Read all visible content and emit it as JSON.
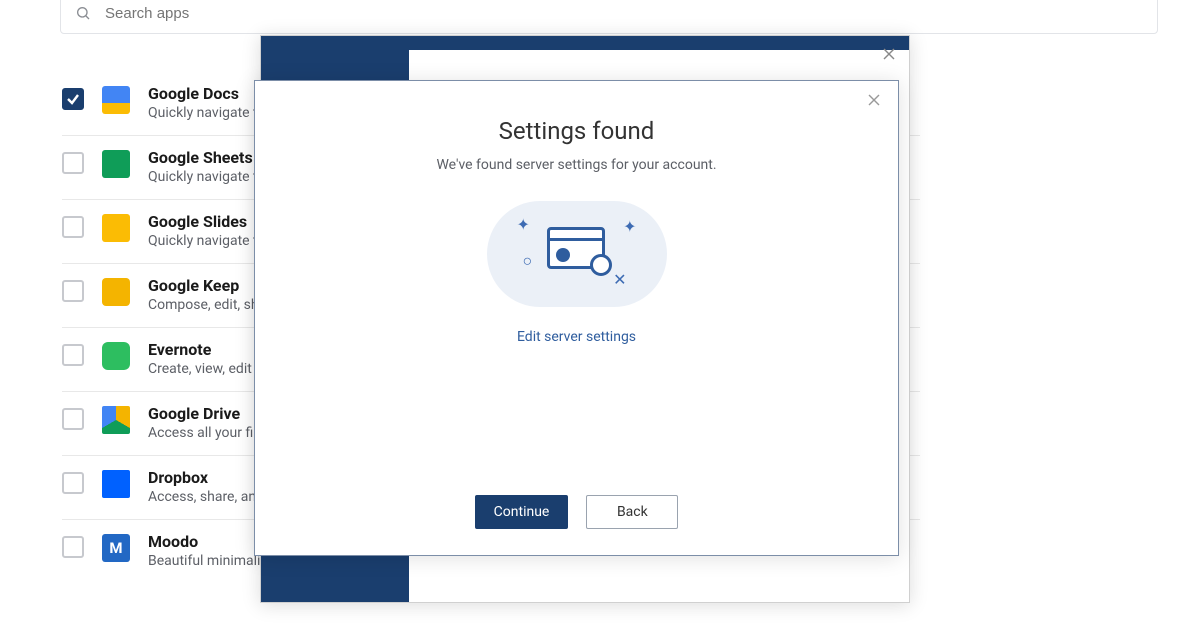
{
  "search": {
    "placeholder": "Search apps"
  },
  "apps": [
    {
      "title": "Google Docs",
      "sub": "Quickly navigate to y",
      "checked": true,
      "iconClass": "ico-docs",
      "iconText": ""
    },
    {
      "title": "Google Sheets",
      "sub": "Quickly navigate to y",
      "checked": false,
      "iconClass": "ico-sheets",
      "iconText": ""
    },
    {
      "title": "Google Slides",
      "sub": "Quickly navigate to y",
      "checked": false,
      "iconClass": "ico-slides",
      "iconText": ""
    },
    {
      "title": "Google Keep",
      "sub": "Compose, edit, share",
      "checked": false,
      "iconClass": "ico-keep",
      "iconText": ""
    },
    {
      "title": "Evernote",
      "sub": "Create, view, edit not",
      "checked": false,
      "iconClass": "ico-evernote",
      "iconText": ""
    },
    {
      "title": "Google Drive",
      "sub": "Access all your files in",
      "checked": false,
      "iconClass": "ico-drive",
      "iconText": ""
    },
    {
      "title": "Dropbox",
      "sub": "Access, share, and or",
      "checked": false,
      "iconClass": "ico-dropbox",
      "iconText": ""
    },
    {
      "title": "Moodo",
      "sub": "Beautiful minimalistic t",
      "checked": false,
      "iconClass": "ico-moodo",
      "iconText": "M"
    }
  ],
  "dialog": {
    "title": "Settings found",
    "subtext": "We've found server settings for your account.",
    "editLink": "Edit server settings",
    "continue": "Continue",
    "back": "Back"
  }
}
